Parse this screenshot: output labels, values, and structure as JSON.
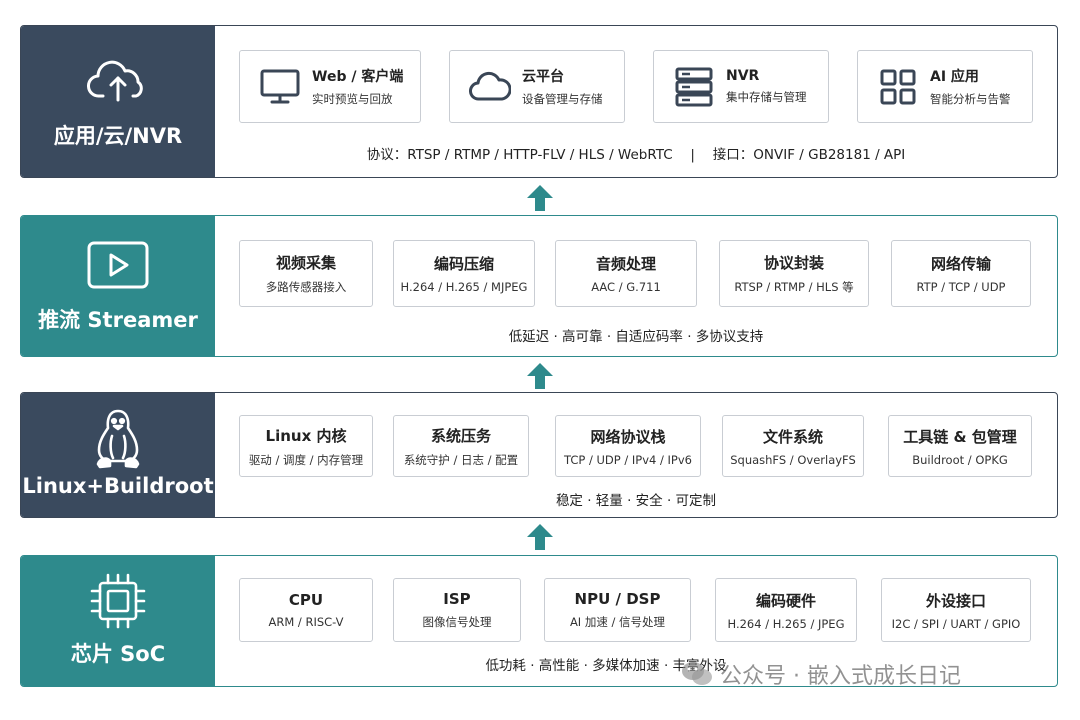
{
  "layers": [
    {
      "title": "应用/云/NVR",
      "icon": "cloud-upload-icon",
      "cards": [
        {
          "title": "Web / 客户端",
          "subtitle": "实时预览与回放",
          "icon": "monitor-icon"
        },
        {
          "title": "云平台",
          "subtitle": "设备管理与存储",
          "icon": "cloud-icon"
        },
        {
          "title": "NVR",
          "subtitle": "集中存储与管理",
          "icon": "server-icon"
        },
        {
          "title": "AI 应用",
          "subtitle": "智能分析与告警",
          "icon": "grid-icon"
        }
      ],
      "footer": "协议：RTSP / RTMP / HTTP-FLV / HLS / WebRTC　 |　 接口：ONVIF / GB28181 / API"
    },
    {
      "title": "推流 Streamer",
      "icon": "play-icon",
      "cards": [
        {
          "title": "视频采集",
          "subtitle": "多路传感器接入"
        },
        {
          "title": "编码压缩",
          "subtitle": "H.264 / H.265 / MJPEG"
        },
        {
          "title": "音频处理",
          "subtitle": "AAC / G.711"
        },
        {
          "title": "协议封装",
          "subtitle": "RTSP / RTMP / HLS 等"
        },
        {
          "title": "网络传输",
          "subtitle": "RTP / TCP / UDP"
        }
      ],
      "footer": "低延迟 · 高可靠 · 自适应码率 · 多协议支持"
    },
    {
      "title": "Linux+Buildroot",
      "icon": "linux-penguin-icon",
      "cards": [
        {
          "title": "Linux 内核",
          "subtitle": "驱动 / 调度 / 内存管理"
        },
        {
          "title": "系统压务",
          "subtitle": "系统守护 / 日志 / 配置"
        },
        {
          "title": "网络协议栈",
          "subtitle": "TCP / UDP / IPv4 / IPv6"
        },
        {
          "title": "文件系统",
          "subtitle": "SquashFS / OverlayFS"
        },
        {
          "title": "工具链 & 包管理",
          "subtitle": "Buildroot / OPKG"
        }
      ],
      "footer": "稳定 · 轻量 · 安全 · 可定制"
    },
    {
      "title": "芯片 SoC",
      "icon": "chip-icon",
      "cards": [
        {
          "title": "CPU",
          "subtitle": "ARM / RISC-V"
        },
        {
          "title": "ISP",
          "subtitle": "图像信号处理"
        },
        {
          "title": "NPU / DSP",
          "subtitle": "AI 加速 / 信号处理"
        },
        {
          "title": "编码硬件",
          "subtitle": "H.264 / H.265 / JPEG"
        },
        {
          "title": "外设接口",
          "subtitle": "I2C / SPI / UART / GPIO"
        }
      ],
      "footer": "低功耗 · 高性能 · 多媒体加速 · 丰富外设"
    }
  ],
  "watermark": "公众号 · 嵌入式成长日记",
  "colors": {
    "dark": "#3a4a5e",
    "teal": "#2e8a8c",
    "arrow": "#2e8a8c",
    "border": "#c9cdd3"
  }
}
